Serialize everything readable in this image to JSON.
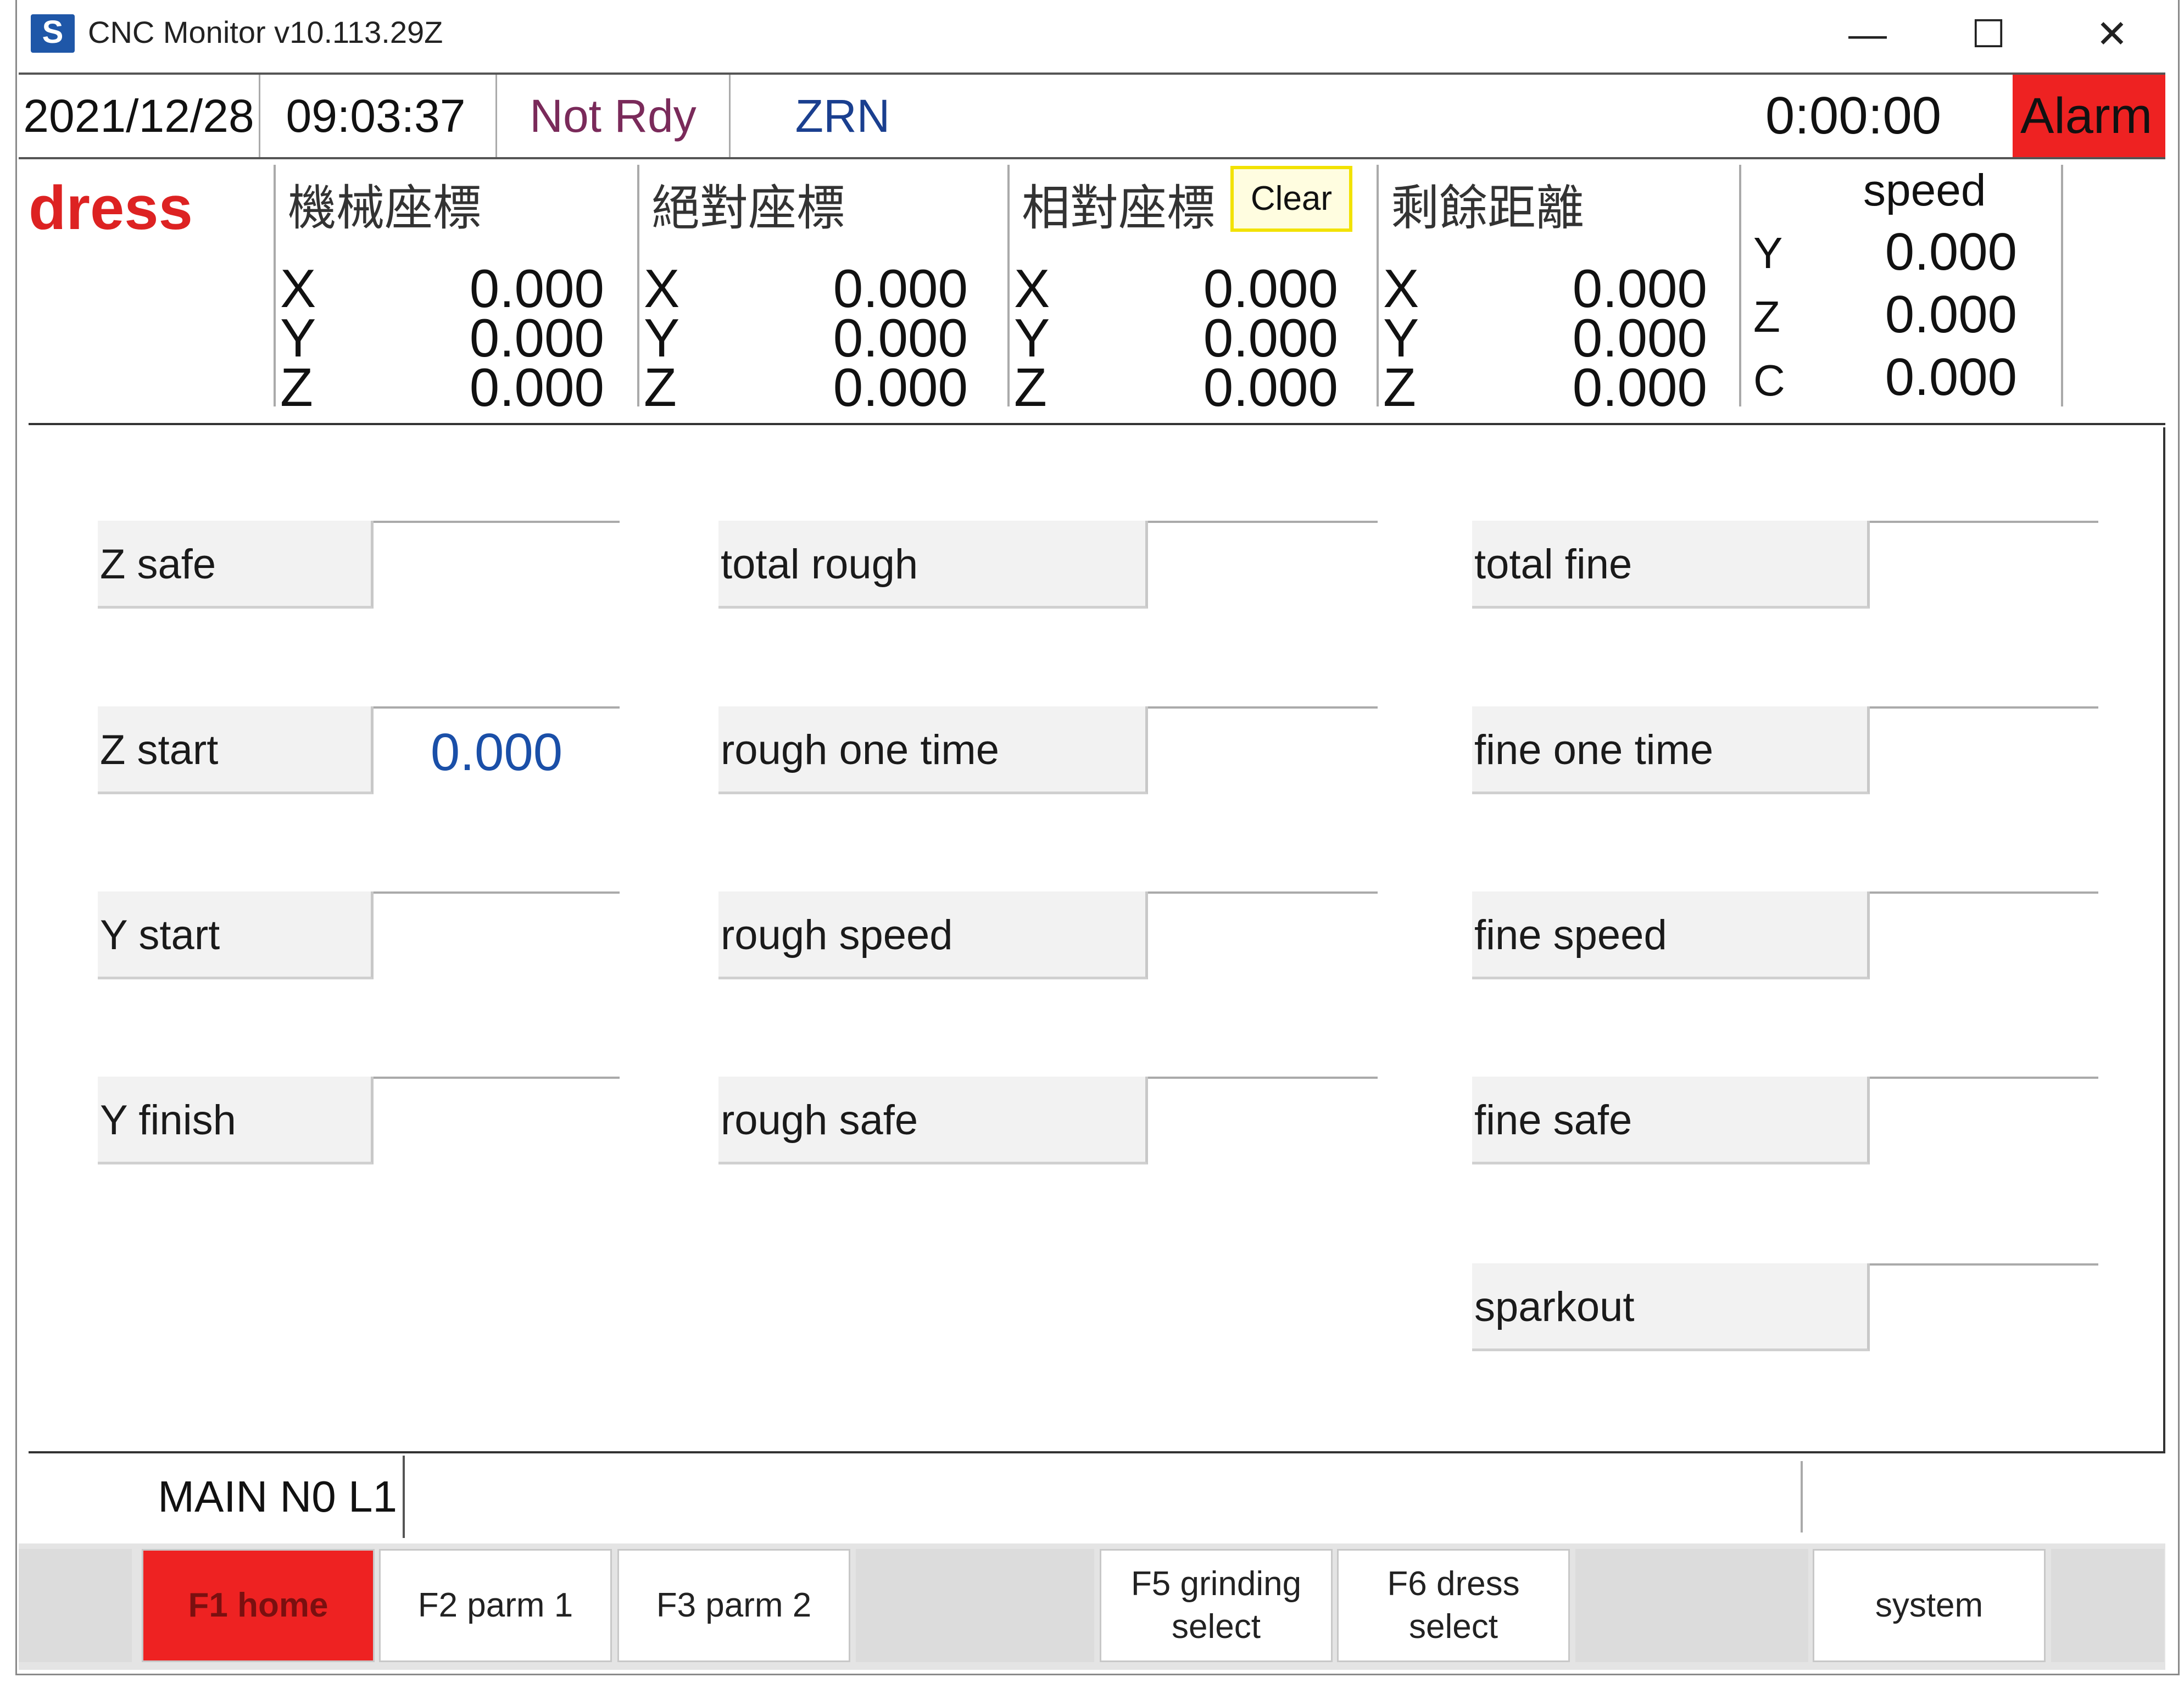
{
  "window": {
    "title": "CNC Monitor v10.113.29Z",
    "icon_letter": "S",
    "minimize": "—",
    "maximize": "☐",
    "close": "✕"
  },
  "status": {
    "date": "2021/12/28",
    "time": "09:03:37",
    "ready": "Not Rdy",
    "mode": "ZRN",
    "timer": "0:00:00",
    "alarm": "Alarm"
  },
  "coords": {
    "mode_title": "dress",
    "clear_label": "Clear",
    "columns": [
      {
        "heading": "機械座標",
        "axes": [
          "X",
          "Y",
          "Z"
        ],
        "values": [
          "0.000",
          "0.000",
          "0.000"
        ]
      },
      {
        "heading": "絕對座標",
        "axes": [
          "X",
          "Y",
          "Z"
        ],
        "values": [
          "0.000",
          "0.000",
          "0.000"
        ]
      },
      {
        "heading": "相對座標",
        "axes": [
          "X",
          "Y",
          "Z"
        ],
        "values": [
          "0.000",
          "0.000",
          "0.000"
        ]
      },
      {
        "heading": "剩餘距離",
        "axes": [
          "X",
          "Y",
          "Z"
        ],
        "values": [
          "0.000",
          "0.000",
          "0.000"
        ]
      }
    ],
    "speed": {
      "heading": "speed",
      "axes": [
        "Y",
        "Z",
        "C"
      ],
      "values": [
        "0.000",
        "0.000",
        "0.000"
      ]
    }
  },
  "params": {
    "col1": [
      {
        "label": "Z safe",
        "value": ""
      },
      {
        "label": "Z start",
        "value": "0.000"
      },
      {
        "label": "Y start",
        "value": ""
      },
      {
        "label": "Y finish",
        "value": ""
      }
    ],
    "col2": [
      {
        "label": "total rough",
        "value": ""
      },
      {
        "label": "rough one time",
        "value": ""
      },
      {
        "label": "rough speed",
        "value": ""
      },
      {
        "label": "rough safe",
        "value": ""
      }
    ],
    "col3": [
      {
        "label": "total fine",
        "value": ""
      },
      {
        "label": "fine one time",
        "value": ""
      },
      {
        "label": "fine speed",
        "value": ""
      },
      {
        "label": "fine safe",
        "value": ""
      },
      {
        "label": "sparkout",
        "value": ""
      }
    ]
  },
  "message": {
    "program": "MAIN N0 L1"
  },
  "fkeys": [
    {
      "label": ""
    },
    {
      "label": "F1 home",
      "active": true
    },
    {
      "label": "F2 parm 1"
    },
    {
      "label": "F3 parm 2"
    },
    {
      "label": ""
    },
    {
      "label": "F5 grinding\nselect"
    },
    {
      "label": "F6 dress\nselect"
    },
    {
      "label": ""
    },
    {
      "label": "system"
    },
    {
      "label": ""
    }
  ],
  "colors": {
    "alarm": "#ee2222",
    "active_key": "#ee2222",
    "mode_title": "#dd2222",
    "clear_border": "#f2e200",
    "value_text": "#1a4fa8"
  }
}
